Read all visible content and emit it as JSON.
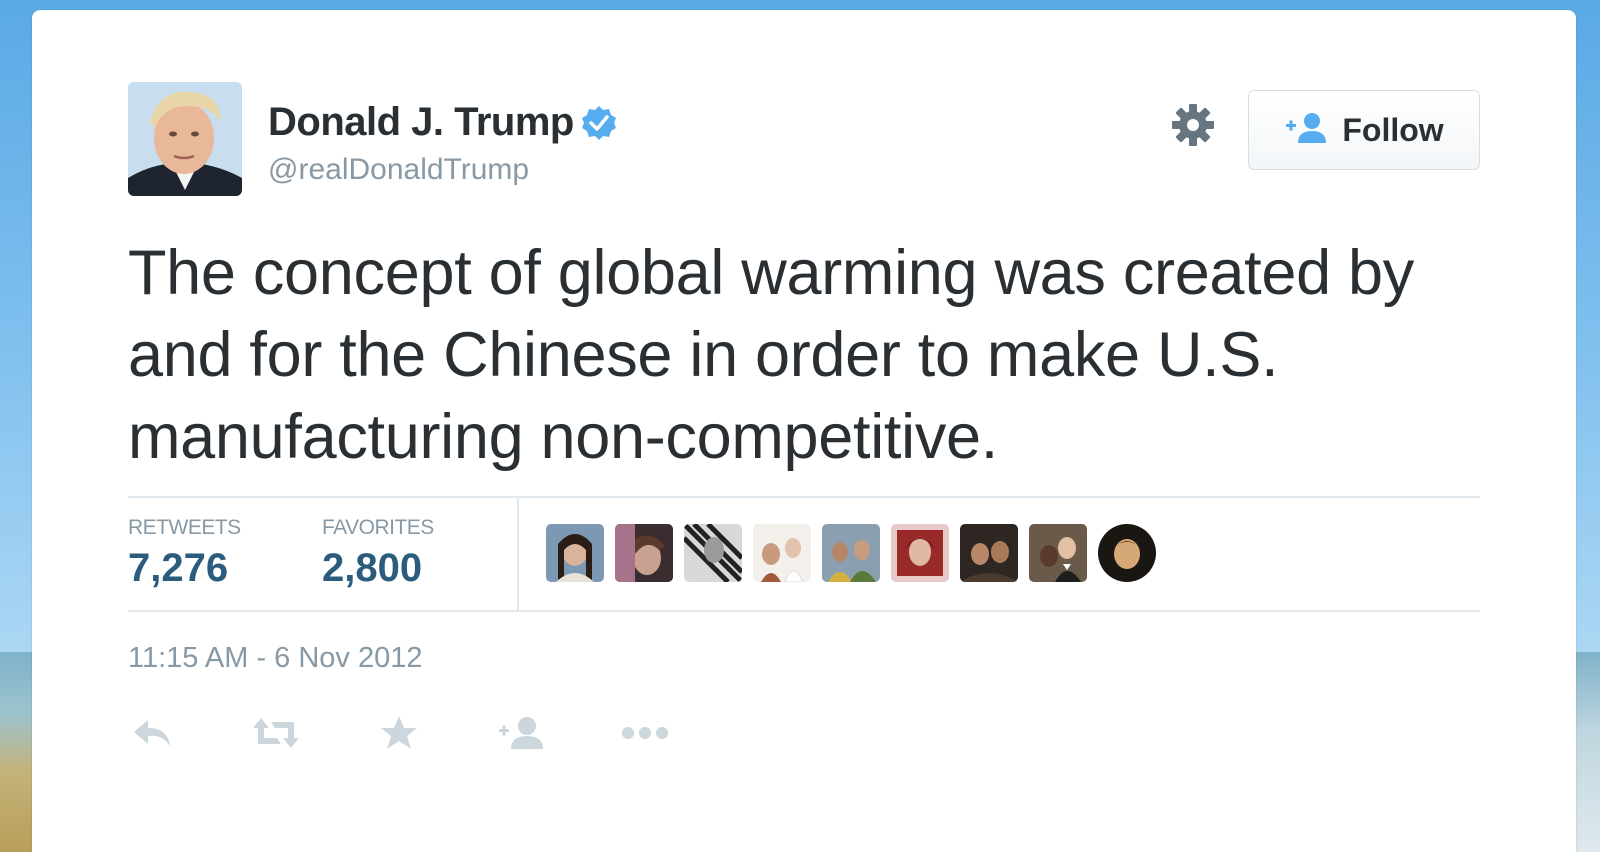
{
  "user": {
    "display_name": "Donald J. Trump",
    "handle": "@realDonaldTrump",
    "verified": true
  },
  "header": {
    "follow_label": "Follow",
    "settings_icon": "gear-icon",
    "follow_icon": "add-user-icon"
  },
  "tweet": {
    "text": "The concept of global warming was created by and for the Chinese in order to make U.S. manufacturing non-competitive.",
    "timestamp": "11:15 AM - 6 Nov 2012"
  },
  "stats": {
    "retweets_label": "RETWEETS",
    "retweets_value": "7,276",
    "favorites_label": "FAVORITES",
    "favorites_value": "2,800"
  },
  "favoriters_count_shown": 9,
  "actions": [
    "reply-icon",
    "retweet-icon",
    "favorite-icon",
    "follow-icon",
    "more-icon"
  ],
  "colors": {
    "text": "#292f33",
    "muted": "#8899a6",
    "stat_value": "#2b5c7d",
    "verified": "#55acee",
    "action_icon": "#ccd6dd",
    "gear": "#66757f"
  }
}
